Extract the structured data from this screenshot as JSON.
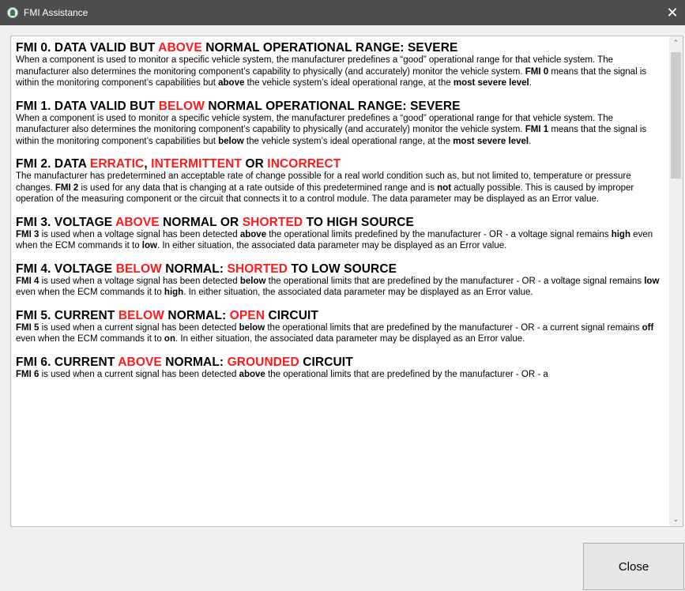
{
  "window": {
    "title": "FMI Assistance",
    "close_glyph": "✕"
  },
  "scroll": {
    "up_glyph": "⌃",
    "down_glyph": "⌄"
  },
  "sections": [
    {
      "heading": [
        "FMI 0. DATA VALID BUT ",
        "ABOVE",
        " NORMAL OPERATIONAL RANGE: SEVERE"
      ],
      "body": [
        "When a component is used to monitor a specific vehicle system, the manufacturer predefines a “good” operational range for that vehicle system. The manufacturer also determines the monitoring component’s capability to physically (and accurately) monitor the vehicle system. ",
        "FMI 0",
        " means that the signal is within the monitoring component’s capabilities but ",
        "above",
        " the vehicle system’s ideal operational range, at the ",
        "most severe level",
        "."
      ]
    },
    {
      "heading": [
        "FMI 1. DATA VALID BUT ",
        "BELOW",
        " NORMAL OPERATIONAL RANGE: SEVERE"
      ],
      "body": [
        "When a component is used to monitor a specific vehicle system, the manufacturer predefines a “good” operational range for that vehicle system. The manufacturer also determines the monitoring component’s capability to physically (and accurately) monitor the vehicle system. ",
        "FMI 1",
        " means that the signal is within the monitoring component’s capabilities but ",
        "below",
        " the vehicle system’s ideal operational range, at the ",
        "most severe level",
        "."
      ]
    },
    {
      "heading": [
        "FMI 2. DATA ",
        "ERRATIC",
        ", ",
        "INTERMITTENT",
        " OR ",
        "INCORRECT"
      ],
      "body": [
        "The manufacturer has predetermined an acceptable rate of change possible for a real world condition such as, but not limited to, temperature or pressure changes. ",
        "FMI 2",
        " is used for any data that is changing at a rate outside of this predetermined range and is ",
        "not",
        " actually possible. This is caused by improper operation of the measuring component or the circuit that connects it to a control module. The data parameter may be displayed as an Error value."
      ]
    },
    {
      "heading": [
        "FMI 3. VOLTAGE ",
        "ABOVE",
        " NORMAL OR ",
        "SHORTED",
        " TO HIGH SOURCE"
      ],
      "body": [
        "",
        "FMI 3",
        " is used when a voltage signal has been detected ",
        "above",
        " the operational limits predefined by the manufacturer - OR - a voltage signal remains ",
        "high",
        " even when the ECM commands it to ",
        "low",
        ". In either situation, the associated data parameter may be displayed as an Error value."
      ]
    },
    {
      "heading": [
        "FMI 4. VOLTAGE ",
        "BELOW",
        " NORMAL: ",
        "SHORTED",
        " TO LOW SOURCE"
      ],
      "body": [
        "",
        "FMI 4",
        " is used when a voltage signal has been detected ",
        "below",
        " the operational limits that are predefined by the manufacturer - OR - a voltage signal remains ",
        "low",
        " even when the ECM commands it to ",
        "high",
        ". In either situation, the associated data parameter may be displayed as an Error value."
      ]
    },
    {
      "heading": [
        "FMI 5. CURRENT ",
        "BELOW",
        " NORMAL: ",
        "OPEN",
        " CIRCUIT"
      ],
      "body": [
        "",
        "FMI 5",
        " is used when a current signal has been detected ",
        "below",
        " the operational limits that are predefined by the manufacturer - OR - a current signal remains ",
        "off",
        " even when the ECM commands it to ",
        "on",
        ". In either situation, the associated data parameter may be displayed as an Error value."
      ]
    },
    {
      "heading": [
        "FMI 6. CURRENT ",
        "ABOVE",
        " NORMAL: ",
        "GROUNDED",
        " CIRCUIT"
      ],
      "body": [
        "",
        "FMI 6",
        " is used when a current signal has been detected ",
        "above",
        " the operational limits that are predefined by the manufacturer - OR - a"
      ]
    }
  ],
  "footer": {
    "close_label": "Close"
  },
  "colors": {
    "titlebar": "#4d4d4d",
    "highlight_red": "#ff1a1a",
    "background": "#f0f0f0"
  }
}
